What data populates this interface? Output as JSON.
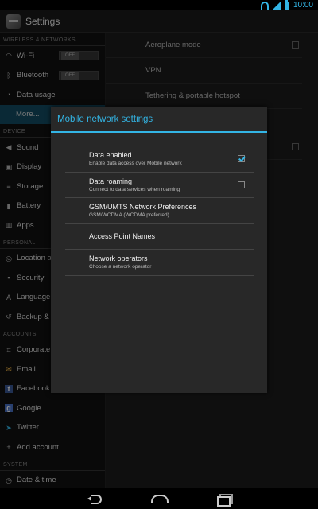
{
  "statusbar": {
    "time": "10:00",
    "icons": [
      "wifi-icon",
      "signal-icon",
      "battery-icon"
    ]
  },
  "actionbar": {
    "title": "Settings",
    "icon": "settings-app-icon"
  },
  "sidebar": {
    "sections": [
      {
        "header": "WIRELESS & NETWORKS",
        "items": [
          {
            "label": "Wi-Fi",
            "icon": "wifi-icon",
            "toggle": "OFF"
          },
          {
            "label": "Bluetooth",
            "icon": "bluetooth-icon",
            "toggle": "OFF"
          },
          {
            "label": "Data usage",
            "icon": "data-usage-icon"
          },
          {
            "label": "More...",
            "icon": "",
            "active": true
          }
        ]
      },
      {
        "header": "DEVICE",
        "items": [
          {
            "label": "Sound",
            "icon": "sound-icon"
          },
          {
            "label": "Display",
            "icon": "display-icon"
          },
          {
            "label": "Storage",
            "icon": "storage-icon"
          },
          {
            "label": "Battery",
            "icon": "battery-icon"
          },
          {
            "label": "Apps",
            "icon": "apps-icon"
          }
        ]
      },
      {
        "header": "PERSONAL",
        "items": [
          {
            "label": "Location a",
            "icon": "location-icon"
          },
          {
            "label": "Security",
            "icon": "lock-icon"
          },
          {
            "label": "Language &",
            "icon": "language-icon"
          },
          {
            "label": "Backup & r",
            "icon": "backup-icon"
          }
        ]
      },
      {
        "header": "ACCOUNTS",
        "items": [
          {
            "label": "Corporate",
            "icon": "corporate-icon"
          },
          {
            "label": "Email",
            "icon": "email-icon"
          },
          {
            "label": "Facebook",
            "icon": "facebook-icon"
          },
          {
            "label": "Google",
            "icon": "google-icon"
          },
          {
            "label": "Twitter",
            "icon": "twitter-icon"
          },
          {
            "label": "Add account",
            "icon": "add-icon"
          }
        ]
      },
      {
        "header": "SYSTEM",
        "items": [
          {
            "label": "Date & time",
            "icon": "clock-icon"
          }
        ]
      }
    ]
  },
  "content": {
    "items": [
      {
        "label": "Aeroplane mode",
        "checkbox": true
      },
      {
        "label": "VPN"
      },
      {
        "label": "Tethering & portable hotspot"
      },
      {
        "label": ""
      },
      {
        "label": "",
        "checkbox": true
      }
    ]
  },
  "dialog": {
    "title": "Mobile network settings",
    "items": [
      {
        "title": "Data enabled",
        "subtitle": "Enable data access over Mobile network",
        "checkbox": "checked"
      },
      {
        "title": "Data roaming",
        "subtitle": "Connect to data services when roaming",
        "checkbox": "unchecked"
      },
      {
        "title": "GSM/UMTS Network Preferences",
        "subtitle": "GSM/WCDMA (WCDMA preferred)"
      },
      {
        "title": "Access Point Names",
        "subtitle": ""
      },
      {
        "title": "Network operators",
        "subtitle": "Choose a network operator"
      }
    ]
  },
  "navbar": {
    "buttons": [
      "back-icon",
      "home-icon",
      "recent-apps-icon"
    ]
  },
  "colors": {
    "accent": "#33b5e5",
    "active_item": "#134c63",
    "dialog_bg": "#282828"
  }
}
